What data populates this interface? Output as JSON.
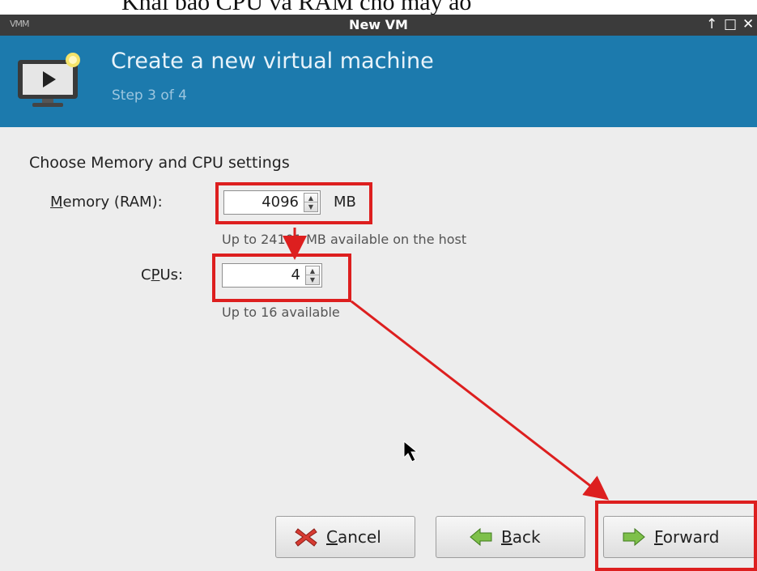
{
  "caption": "Khai báo CPU và RAM cho máy ảo",
  "window": {
    "title": "New VM",
    "controls": [
      "↑",
      "□",
      "✕"
    ]
  },
  "header": {
    "title": "Create a new virtual machine",
    "step": "Step 3 of 4"
  },
  "form": {
    "section_title": "Choose Memory and CPU settings",
    "memory": {
      "label_mnemonic": "M",
      "label_rest": "emory (RAM):",
      "value": "4096",
      "unit": "MB",
      "hint": "Up to 24101 MB available on the host"
    },
    "cpus": {
      "label_pre": "C",
      "label_mnemonic": "P",
      "label_rest": "Us:",
      "value": "4",
      "hint": "Up to 16 available"
    }
  },
  "buttons": {
    "cancel": {
      "mnemonic": "C",
      "rest": "ancel"
    },
    "back": {
      "mnemonic": "B",
      "rest": "ack"
    },
    "forward": {
      "mnemonic": "F",
      "rest": "orward"
    }
  },
  "colors": {
    "header_bg": "#1c7aad",
    "titlebar_bg": "#3b3b3b",
    "annotation": "#dd1f1f"
  },
  "icons": {
    "header": "monitor-play-icon",
    "cancel": "red-x-icon",
    "back": "green-left-arrow-icon",
    "forward": "green-right-arrow-icon"
  }
}
